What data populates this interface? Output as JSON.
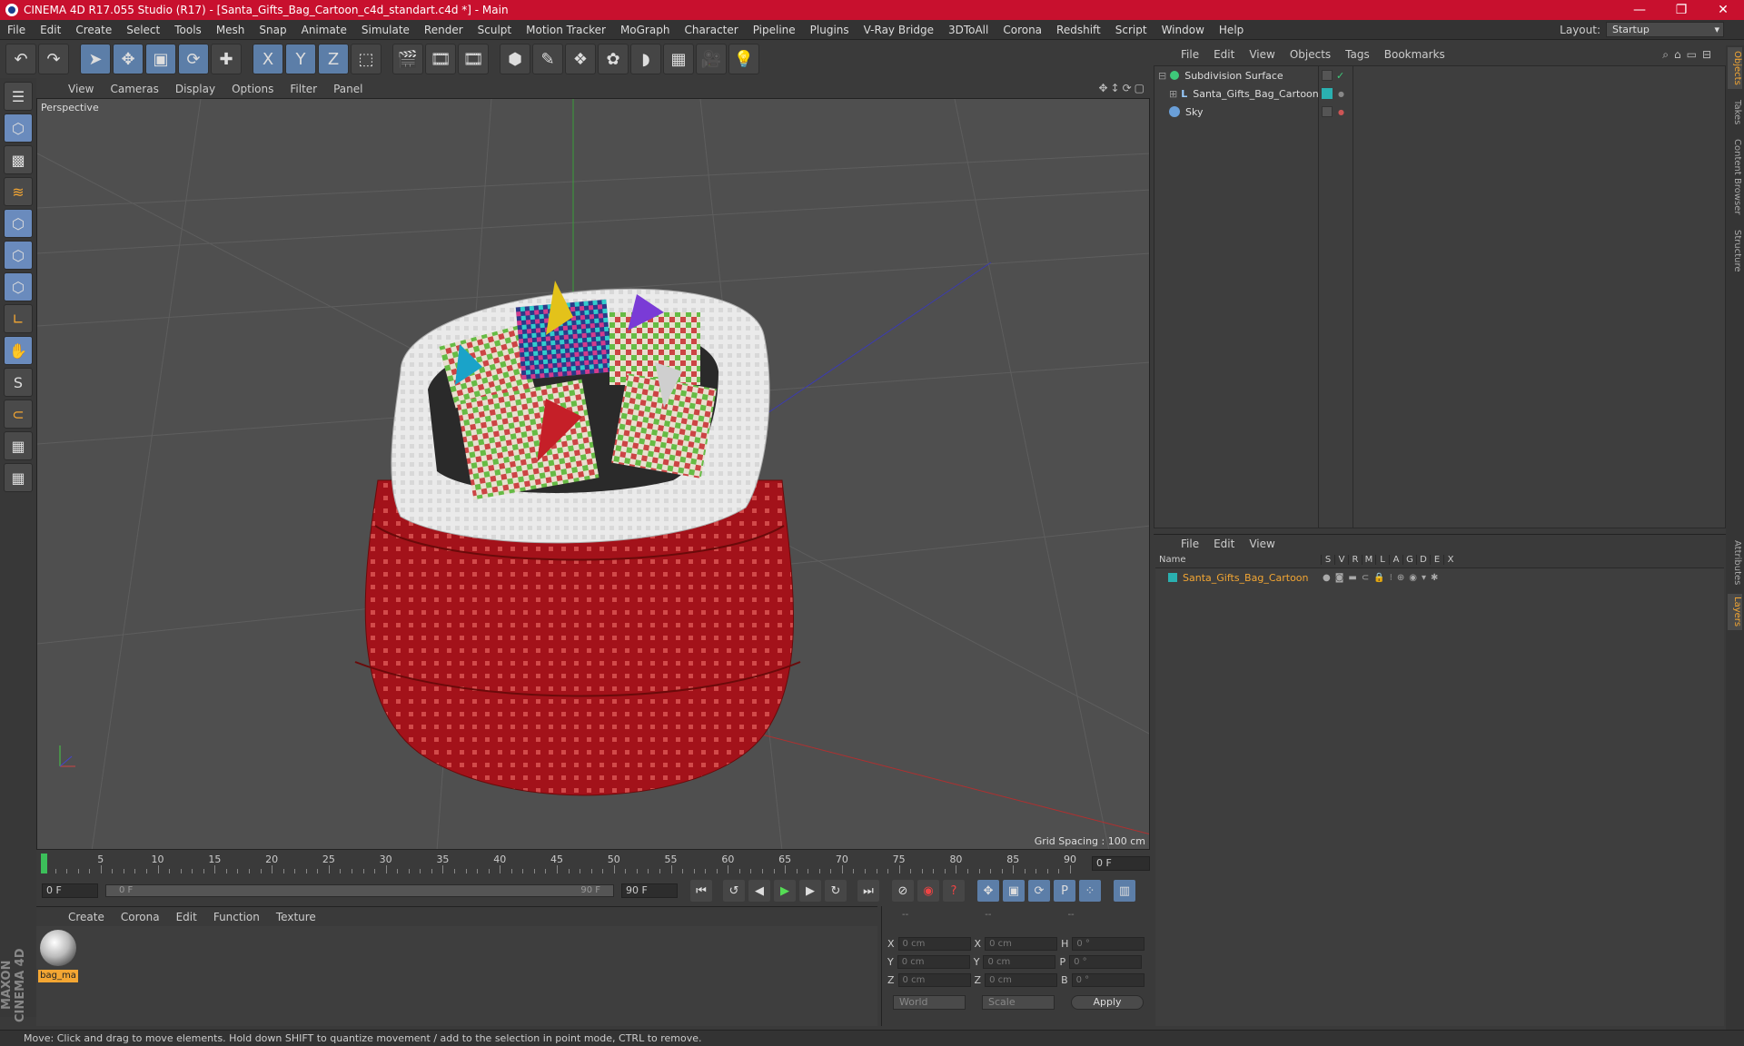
{
  "window": {
    "title": "CINEMA 4D R17.055 Studio (R17) - [Santa_Gifts_Bag_Cartoon_c4d_standart.c4d *] - Main",
    "minimize": "—",
    "restore": "❐",
    "close": "✕"
  },
  "menu": [
    "File",
    "Edit",
    "Create",
    "Select",
    "Tools",
    "Mesh",
    "Snap",
    "Animate",
    "Simulate",
    "Render",
    "Sculpt",
    "Motion Tracker",
    "MoGraph",
    "Character",
    "Pipeline",
    "Plugins",
    "V-Ray Bridge",
    "3DToAll",
    "Corona",
    "Redshift",
    "Script",
    "Window",
    "Help"
  ],
  "layout": {
    "label": "Layout:",
    "value": "Startup"
  },
  "toolbar_icons": [
    "undo-icon",
    "redo-icon",
    "select-icon",
    "move-icon",
    "scale-icon",
    "rotate-icon",
    "create-icon",
    "x-axis-icon",
    "y-axis-icon",
    "z-axis-icon",
    "world-coord-icon",
    "render-view-icon",
    "render-picture-icon",
    "edit-render-icon",
    "cube-icon",
    "pen-icon",
    "subdivide-icon",
    "array-icon",
    "deformer-icon",
    "floor-icon",
    "camera-icon",
    "light-icon"
  ],
  "toolbar_glyphs": [
    "↶",
    "↷",
    "➤",
    "✥",
    "▣",
    "⟳",
    "✚",
    "X",
    "Y",
    "Z",
    "⬚",
    "🎬",
    "🎞",
    "🎞",
    "⬢",
    "✎",
    "❖",
    "✿",
    "◗",
    "▦",
    "🎥",
    "💡"
  ],
  "left_tools": [
    "☰",
    "⬡",
    "▩",
    "≋",
    "⬡",
    "⬡",
    "⬡",
    "∟",
    "✋",
    "S",
    "⊂",
    "▦",
    "▦"
  ],
  "viewport": {
    "menu": [
      "View",
      "Cameras",
      "Display",
      "Options",
      "Filter",
      "Panel"
    ],
    "label": "Perspective",
    "grid_spacing": "Grid Spacing : 100 cm"
  },
  "timeline": {
    "ticks": [
      "0",
      "5",
      "10",
      "15",
      "20",
      "25",
      "30",
      "35",
      "40",
      "45",
      "50",
      "55",
      "60",
      "65",
      "70",
      "75",
      "80",
      "85",
      "90"
    ],
    "current": "0 F",
    "start": "0 F",
    "range_start": "0 F",
    "range_end": "90 F",
    "end": "90 F"
  },
  "material": {
    "menu": [
      "Create",
      "Corona",
      "Edit",
      "Function",
      "Texture"
    ],
    "name": "bag_ma"
  },
  "coords": {
    "header": [
      "--",
      "--",
      "--"
    ],
    "rows": [
      {
        "a": "X",
        "v1": "0 cm",
        "b": "X",
        "v2": "0 cm",
        "c": "H",
        "v3": "0 °"
      },
      {
        "a": "Y",
        "v1": "0 cm",
        "b": "Y",
        "v2": "0 cm",
        "c": "P",
        "v3": "0 °"
      },
      {
        "a": "Z",
        "v1": "0 cm",
        "b": "Z",
        "v2": "0 cm",
        "c": "B",
        "v3": "0 °"
      }
    ],
    "mode1": "World",
    "mode2": "Scale",
    "apply": "Apply"
  },
  "objects": {
    "menu": [
      "File",
      "Edit",
      "View",
      "Objects",
      "Tags",
      "Bookmarks"
    ],
    "items": [
      {
        "name": "Subdivision Surface",
        "color": "#3ec97a"
      },
      {
        "name": "Santa_Gifts_Bag_Cartoon",
        "color": "#2ab0b0"
      },
      {
        "name": "Sky",
        "color": "#6a9fd8"
      }
    ]
  },
  "layers": {
    "menu": [
      "File",
      "Edit",
      "View"
    ],
    "header": {
      "name": "Name",
      "cols": [
        "S",
        "V",
        "R",
        "M",
        "L",
        "A",
        "G",
        "D",
        "E",
        "X"
      ]
    },
    "items": [
      {
        "name": "Santa_Gifts_Bag_Cartoon",
        "color": "#2ab0b0"
      }
    ]
  },
  "side_tabs": [
    "Objects",
    "Takes",
    "Content Browser",
    "Structure",
    "Attributes",
    "Layers"
  ],
  "branding": "MAXON CINEMA 4D",
  "status": "Move: Click and drag to move elements. Hold down SHIFT to quantize movement / add to the selection in point mode, CTRL to remove."
}
